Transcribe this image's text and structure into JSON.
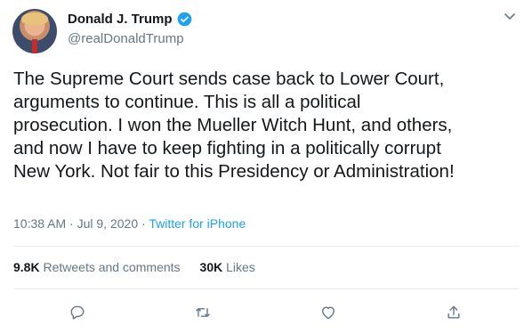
{
  "user": {
    "display_name": "Donald J. Trump",
    "handle": "@realDonaldTrump",
    "verified": true
  },
  "tweet": {
    "text": "The Supreme Court sends case back to Lower Court,\narguments to continue. This is all a political\nprosecution. I won the Mueller Witch Hunt, and others,\nand now I have to keep fighting in a politically corrupt\nNew York. Not fair to this Presidency or Administration!",
    "time": "10:38 AM",
    "date": "Jul 9, 2020",
    "separator": "·",
    "source": "Twitter for iPhone"
  },
  "stats": {
    "retweets_count": "9.8K",
    "retweets_label": "Retweets and comments",
    "likes_count": "30K",
    "likes_label": "Likes"
  },
  "icons": {
    "avatar": "profile-photo",
    "verified": "verified-badge-icon",
    "menu": "chevron-down-icon",
    "reply": "reply-icon",
    "retweet": "retweet-icon",
    "like": "heart-icon",
    "share": "share-icon"
  },
  "colors": {
    "accent": "#1da1f2",
    "text": "#14171a",
    "secondary": "#657786",
    "divider": "#e6ecf0"
  }
}
